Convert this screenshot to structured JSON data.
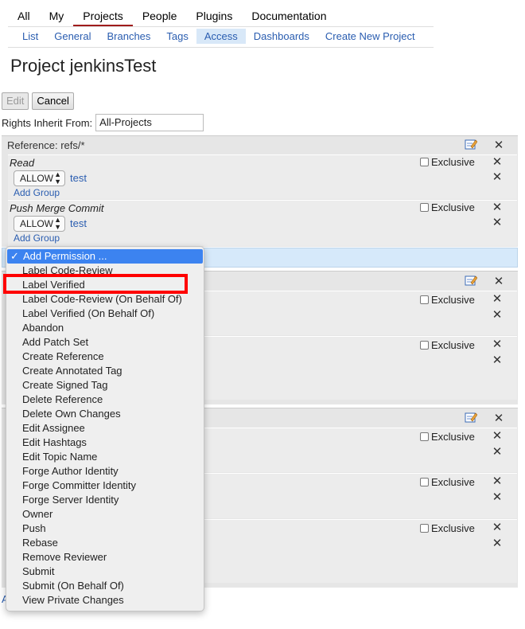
{
  "topnav": {
    "tabs": [
      "All",
      "My",
      "Projects",
      "People",
      "Plugins",
      "Documentation"
    ],
    "active": "Projects"
  },
  "subnav": {
    "items": [
      "List",
      "General",
      "Branches",
      "Tags",
      "Access",
      "Dashboards",
      "Create New Project"
    ],
    "active": "Access"
  },
  "page_title": "Project jenkinsTest",
  "buttons": {
    "edit": "Edit",
    "cancel": "Cancel"
  },
  "inherit": {
    "label": "Rights Inherit From:",
    "value": "All-Projects"
  },
  "reference": {
    "label": "Reference: refs/*",
    "permissions": [
      {
        "name": "Read",
        "action": "ALLOW",
        "group": "test",
        "add_group": "Add Group",
        "exclusive": "Exclusive"
      },
      {
        "name": "Push Merge Commit",
        "action": "ALLOW",
        "group": "test",
        "add_group": "Add Group",
        "exclusive": "Exclusive"
      }
    ]
  },
  "exclusive_label": "Exclusive",
  "dropdown": {
    "selected": "Add Permission ...",
    "items": [
      "Label Code-Review",
      "Label Verified",
      "Label Code-Review (On Behalf Of)",
      "Label Verified (On Behalf Of)",
      "Abandon",
      "Add Patch Set",
      "Create Reference",
      "Create Annotated Tag",
      "Create Signed Tag",
      "Delete Reference",
      "Delete Own Changes",
      "Edit Assignee",
      "Edit Hashtags",
      "Edit Topic Name",
      "Forge Author Identity",
      "Forge Committer Identity",
      "Forge Server Identity",
      "Owner",
      "Push",
      "Rebase",
      "Remove Reviewer",
      "Submit",
      "Submit (On Behalf Of)",
      "View Private Changes"
    ],
    "highlighted": "Label Verified"
  },
  "stray_link": "A",
  "colors": {
    "active_tab_underline": "#a01c1c",
    "link": "#2a5db0",
    "menu_selected": "#3c83f0",
    "highlight_box": "#ff0000"
  }
}
